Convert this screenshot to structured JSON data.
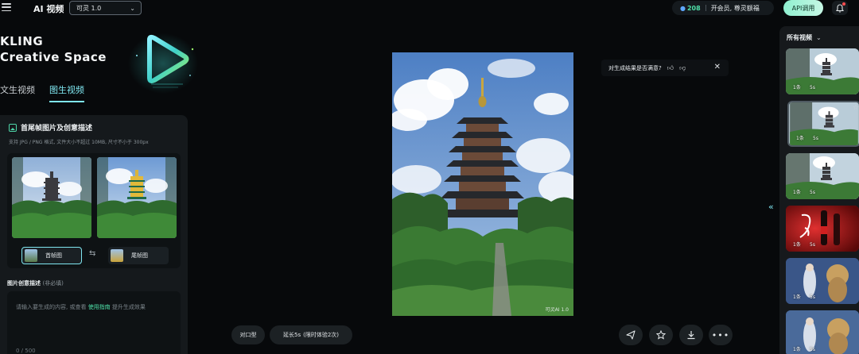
{
  "header": {
    "app_title": "AI 视频",
    "model": "可灵 1.0",
    "credits": "208",
    "vip": "开会员, 尊灵额福",
    "api_label": "API调用"
  },
  "brand": {
    "line1": "KLING",
    "line2": "Creative Space"
  },
  "mode_tabs": [
    {
      "label": "文生视频"
    },
    {
      "label": "图生视频"
    }
  ],
  "panel": {
    "title": "首尾帧图片及创意描述",
    "subtitle": "支持 JPG / PNG 格式, 文件大小不超过 10MB, 尺寸不小于 300px",
    "first_frame_label": "首帧图",
    "last_frame_label": "尾帧图",
    "desc_label": "图片创意描述",
    "desc_optional": "(非必填)",
    "desc_placeholder_pre": "请输入要生成的内容, 或查看",
    "desc_placeholder_link": "使用指南",
    "desc_placeholder_post": "提升生成效果",
    "char_count": "0 / 500"
  },
  "preview": {
    "watermark": "可灵AI 1.0"
  },
  "feedback": {
    "question": "对生成结果是否满意?"
  },
  "actions": {
    "lip_sync": "对口型",
    "extend": "延长5s",
    "extend_note": "(限时体验2次)"
  },
  "history": {
    "title": "所有视频",
    "items": [
      {
        "count": "1条",
        "duration": "5s"
      },
      {
        "count": "1条",
        "duration": "5s"
      },
      {
        "count": "1条",
        "duration": "5s"
      },
      {
        "count": "1条",
        "duration": "5s"
      },
      {
        "count": "1条",
        "duration": "5s"
      },
      {
        "count": "1条",
        "duration": "5s"
      }
    ]
  },
  "colors": {
    "accent": "#7fe6f0",
    "green": "#4ee0a8",
    "panel_bg": "#15191c",
    "page_bg": "#07090b"
  }
}
